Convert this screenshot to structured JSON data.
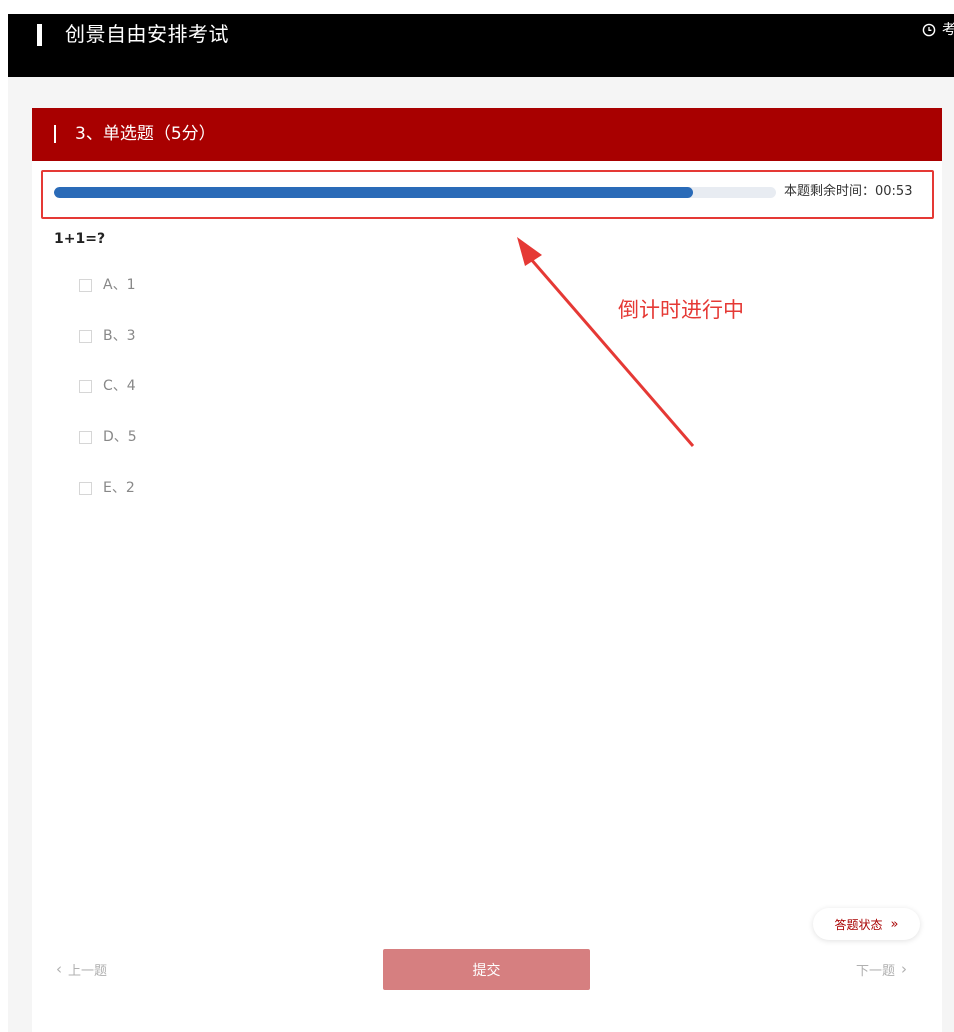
{
  "header": {
    "title": "创景自由安排考试",
    "clock_icon": "clock-icon",
    "clock_text": "考"
  },
  "question": {
    "heading": "3、单选题（5分）",
    "timer_label": "本题剩余时间：00:53",
    "progress_fraction": 0.885,
    "text": "1+1=?",
    "options": [
      {
        "label": "A、1"
      },
      {
        "label": "B、3"
      },
      {
        "label": "C、4"
      },
      {
        "label": "D、5"
      },
      {
        "label": "E、2"
      }
    ]
  },
  "footer": {
    "status_label": "答题状态",
    "status_icon": "double-chevron-right-icon",
    "prev_label": "上一题",
    "next_label": "下一题",
    "submit_label": "提交"
  },
  "annotation": {
    "text": "倒计时进行中"
  },
  "colors": {
    "header_bg": "#000000",
    "card_head_bg": "#a80000",
    "progress_fill": "#2a6bb8",
    "progress_track": "#e8ecf2",
    "annotation_red": "#e53935",
    "submit_bg": "#d67f80"
  }
}
